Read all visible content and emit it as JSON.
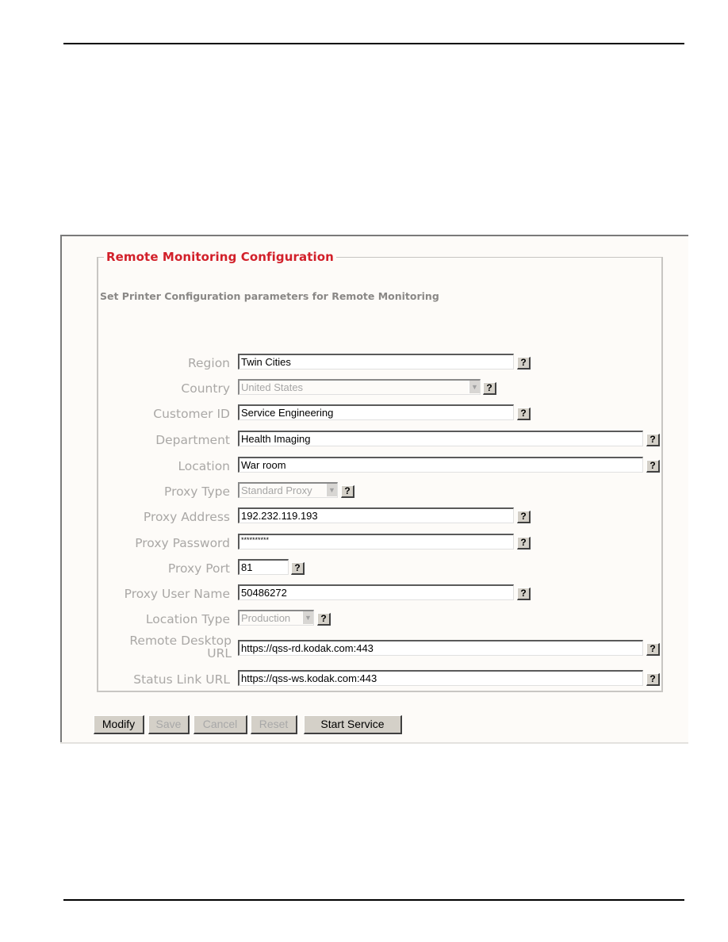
{
  "panel": {
    "legend": "Remote Monitoring Configuration",
    "subtitle": "Set Printer Configuration parameters for Remote Monitoring"
  },
  "fields": {
    "region": {
      "label": "Region",
      "value": "Twin Cities"
    },
    "country": {
      "label": "Country",
      "value": "United States",
      "disabled": true
    },
    "customer_id": {
      "label": "Customer ID",
      "value": "Service Engineering"
    },
    "department": {
      "label": "Department",
      "value": "Health Imaging"
    },
    "location": {
      "label": "Location",
      "value": "War room"
    },
    "proxy_type": {
      "label": "Proxy Type",
      "value": "Standard Proxy",
      "disabled": true
    },
    "proxy_address": {
      "label": "Proxy Address",
      "value": "192.232.119.193"
    },
    "proxy_password": {
      "label": "Proxy Password",
      "value": "**********"
    },
    "proxy_port": {
      "label": "Proxy Port",
      "value": "81"
    },
    "proxy_user_name": {
      "label": "Proxy User Name",
      "value": "50486272"
    },
    "location_type": {
      "label": "Location Type",
      "value": "Production",
      "disabled": true
    },
    "remote_desktop_url": {
      "label_line1": "Remote Desktop",
      "label_line2": "URL",
      "value": "https://qss-rd.kodak.com:443"
    },
    "status_link_url": {
      "label": "Status Link URL",
      "value": "https://qss-ws.kodak.com:443"
    }
  },
  "icons": {
    "help": "?",
    "dropdown": "▼"
  },
  "buttons": {
    "modify": "Modify",
    "save": "Save",
    "cancel": "Cancel",
    "reset": "Reset",
    "start_service": "Start Service"
  },
  "colors": {
    "legend": "#d2202a",
    "label": "#aaa8a6",
    "panel_bg": "#fdfbf8"
  }
}
